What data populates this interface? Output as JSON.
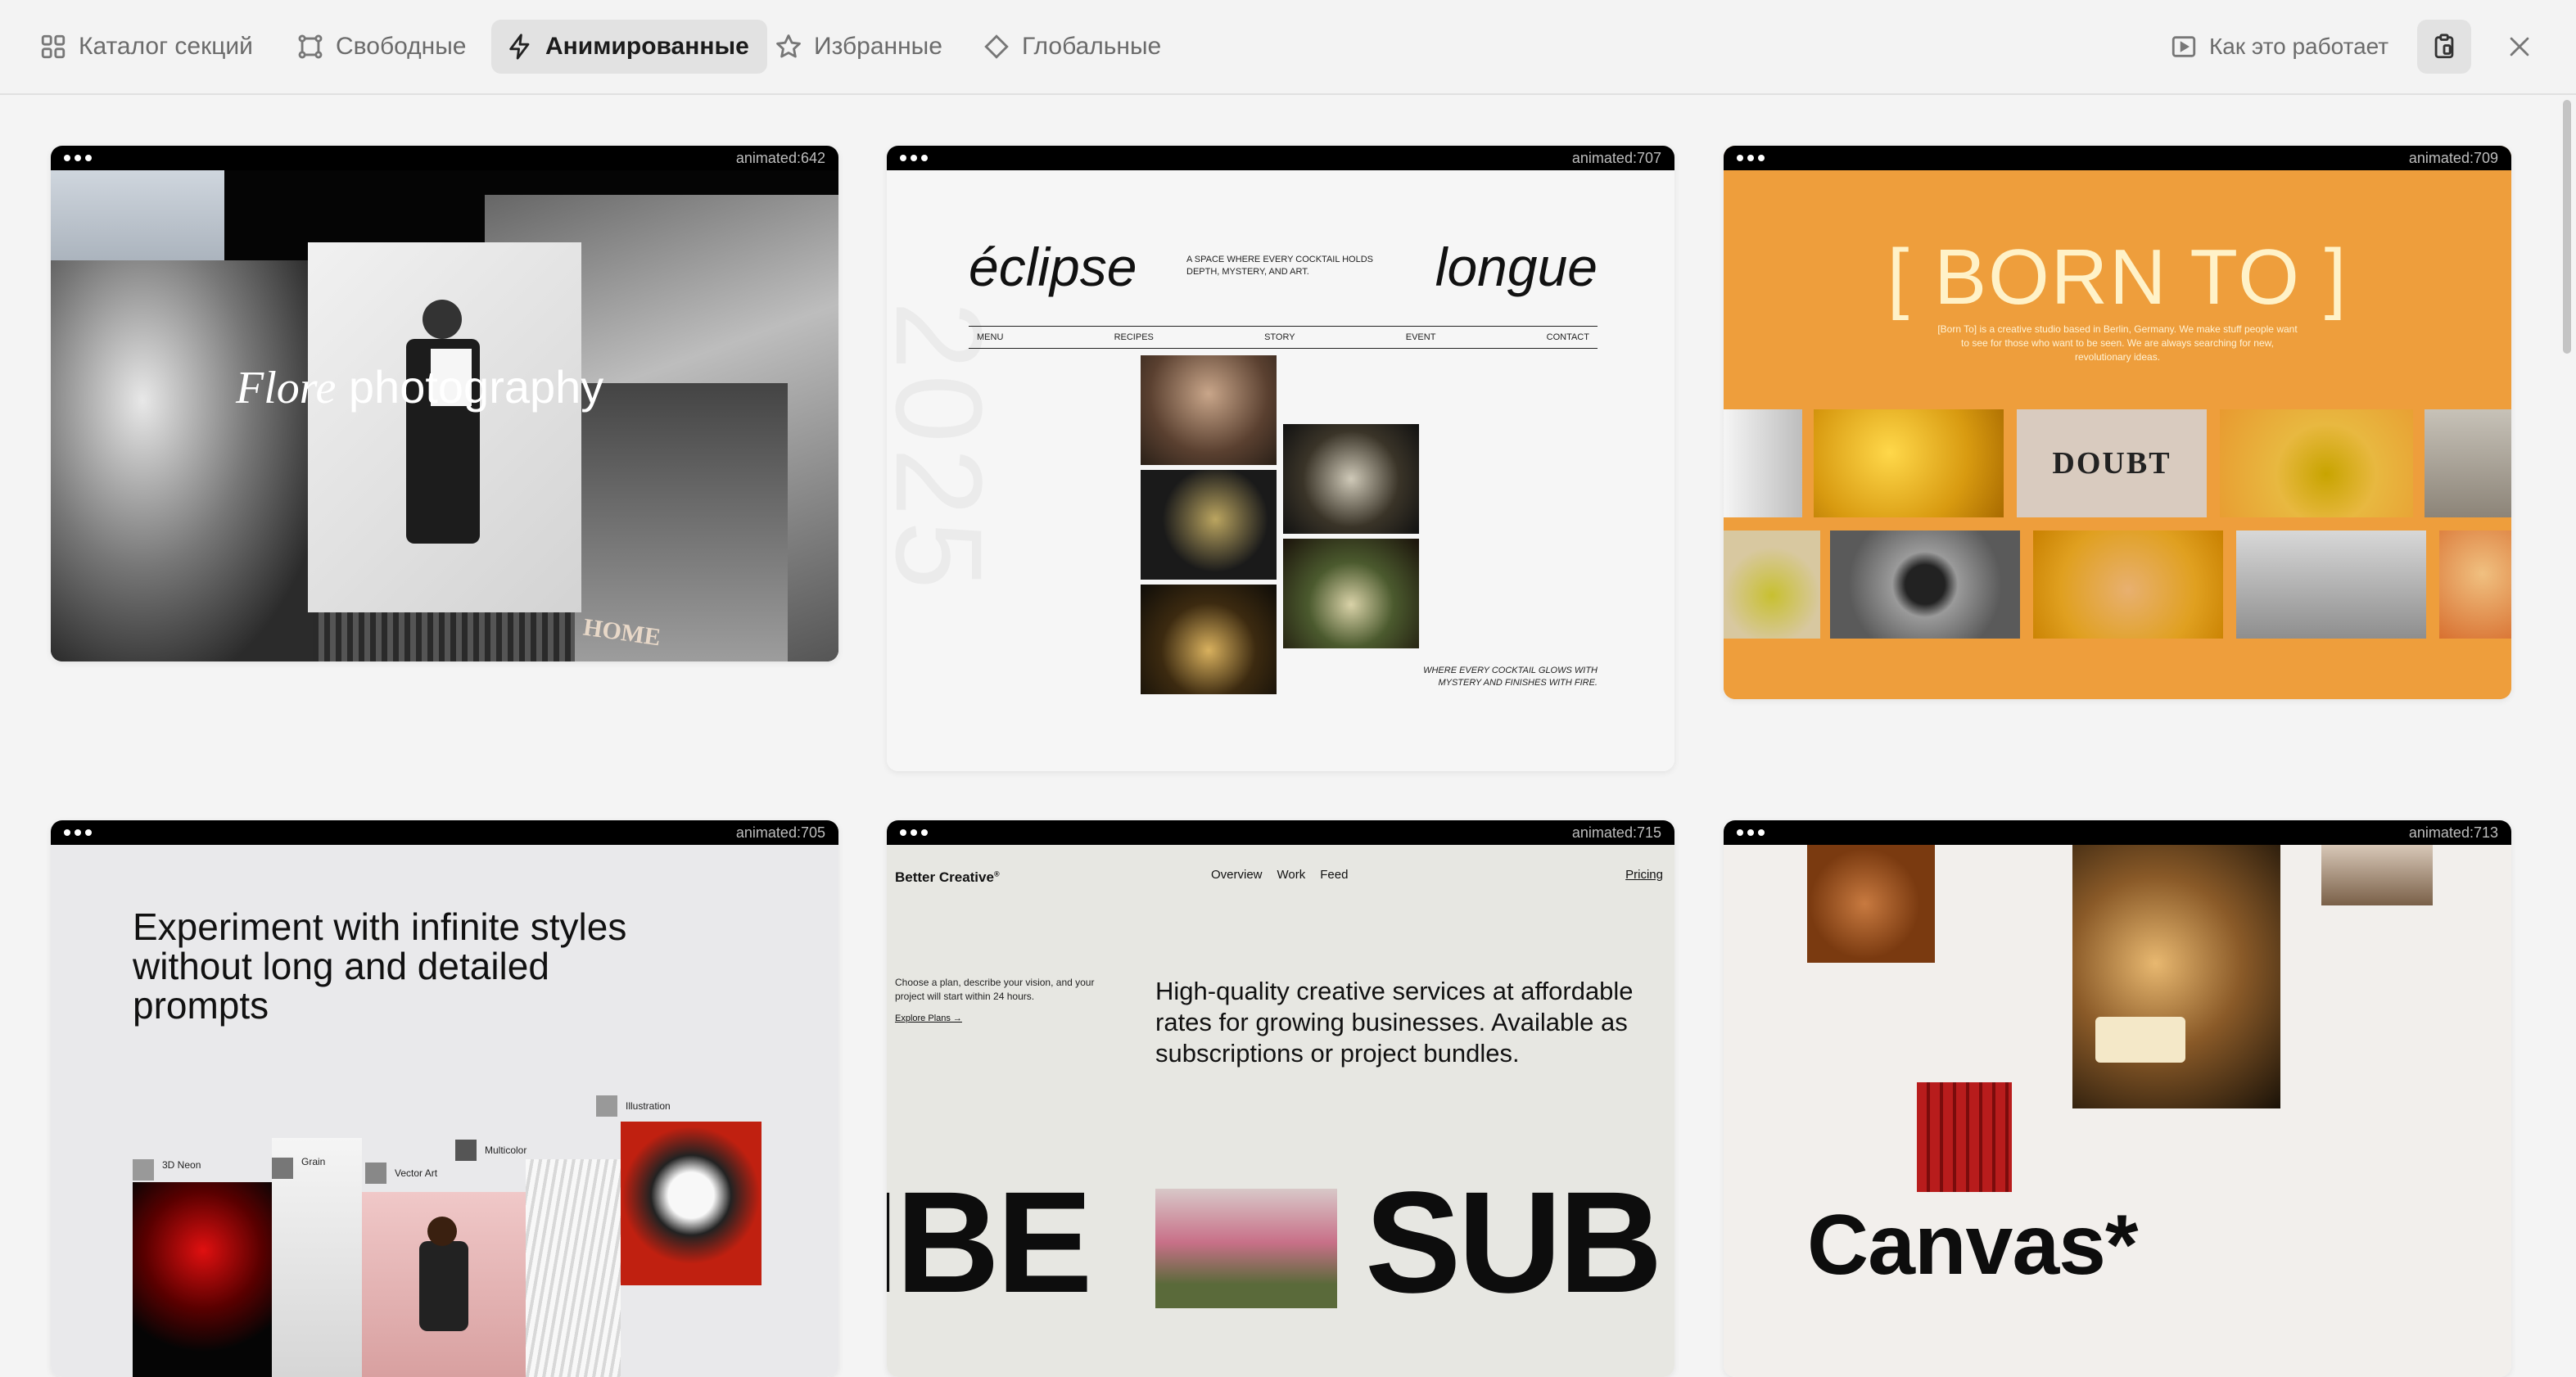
{
  "tabs": [
    {
      "label": "Каталог секций",
      "icon": "grid-icon"
    },
    {
      "label": "Свободные",
      "icon": "frame-icon"
    },
    {
      "label": "Анимированные",
      "icon": "lightning-icon",
      "active": true
    },
    {
      "label": "Избранные",
      "icon": "star-icon"
    },
    {
      "label": "Глобальные",
      "icon": "diamond-icon"
    }
  ],
  "header": {
    "howto_label": "Как это работает",
    "howto_icon": "play-icon",
    "clip_icon": "clipboard-icon",
    "close_icon": "close-icon"
  },
  "cards": [
    {
      "id": "animated:642",
      "script_word": "Flore",
      "title_word": "photography",
      "sign": "HOME"
    },
    {
      "id": "animated:707",
      "left_title": "éclipse",
      "right_title": "longue",
      "tagline": "A SPACE WHERE EVERY COCKTAIL HOLDS DEPTH, MYSTERY, AND ART.",
      "nav": [
        "MENU",
        "RECIPES",
        "STORY",
        "EVENT",
        "CONTACT"
      ],
      "year": "2025",
      "footer": "WHERE EVERY COCKTAIL GLOWS WITH MYSTERY AND FINISHES WITH FIRE."
    },
    {
      "id": "animated:709",
      "title": "[ BORN TO ]",
      "desc": "[Born To] is a creative studio based in Berlin, Germany. We make stuff people want to see for those who want to be seen. We are always searching for new, revolutionary ideas.",
      "tile_word": "DOUBT"
    },
    {
      "id": "animated:705",
      "headline": "Experiment with infinite styles without long and detailed prompts",
      "styles": [
        "3D Neon",
        "Grain",
        "Vector Art",
        "Multicolor",
        "Illustration"
      ]
    },
    {
      "id": "animated:715",
      "brand": "Better Creative",
      "nav": [
        "Overview",
        "Work",
        "Feed"
      ],
      "pricing": "Pricing",
      "intro": "Choose a plan, describe your vision, and your project will start within 24 hours.",
      "explore": "Explore Plans →",
      "headline": "High-quality creative services at affordable rates for growing businesses. Available as subscriptions or project bundles.",
      "big_left": "IBE",
      "big_right": "SUB"
    },
    {
      "id": "animated:713",
      "title": "Canvas*"
    }
  ],
  "colors": {
    "accent_orange": "#ee9e3c",
    "topbar_bg": "#f3f3f3",
    "active_tab_bg": "#e2e2e2"
  }
}
